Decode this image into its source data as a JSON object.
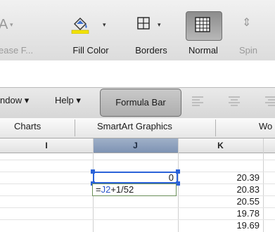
{
  "ribbon": {
    "partial_left_label": "ease F...",
    "partial_left_glyph": "A",
    "fill_color_label": "Fill Color",
    "borders_label": "Borders",
    "normal_label": "Normal",
    "spin_label": "Spin",
    "fill_accent": "#f2e200"
  },
  "toolbar": {
    "window_menu": "ndow ▾",
    "help_menu": "Help ▾",
    "formula_bar_button": "Formula Bar"
  },
  "tabs": [
    "Charts",
    "SmartArt Graphics",
    "Wo"
  ],
  "columns": {
    "i": "I",
    "j": "J",
    "k": "K"
  },
  "cells": {
    "j2": "0",
    "k": [
      "20.39",
      "20.83",
      "20.55",
      "19.78",
      "19.69"
    ]
  },
  "editor": {
    "prefix": "=",
    "ref": "J2",
    "suffix": "+1/52",
    "ref_color": "#2b56c9"
  },
  "selection_color": "#2b63d9"
}
